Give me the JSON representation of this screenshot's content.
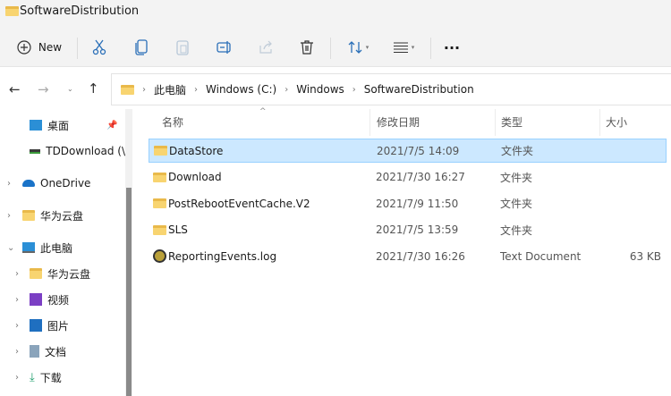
{
  "window": {
    "title": "SoftwareDistribution"
  },
  "toolbar": {
    "new_label": "New",
    "icons": [
      "cut-icon",
      "copy-icon",
      "paste-icon",
      "rename-icon",
      "share-icon",
      "delete-icon",
      "sort-icon",
      "view-icon",
      "more-icon"
    ]
  },
  "nav": {
    "breadcrumb": [
      "此电脑",
      "Windows (C:)",
      "Windows",
      "SoftwareDistribution"
    ]
  },
  "sidebar": {
    "items": [
      {
        "label": "桌面"
      },
      {
        "label": "TDDownload (\\"
      },
      {
        "label": "OneDrive"
      },
      {
        "label": "华为云盘"
      },
      {
        "label": "此电脑"
      },
      {
        "label": "华为云盘"
      },
      {
        "label": "视频"
      },
      {
        "label": "图片"
      },
      {
        "label": "文档"
      },
      {
        "label": "下载"
      }
    ]
  },
  "list": {
    "columns": [
      "名称",
      "修改日期",
      "类型",
      "大小"
    ],
    "rows": [
      {
        "name": "DataStore",
        "date": "2021/7/5 14:09",
        "type": "文件夹",
        "size": "",
        "selected": true
      },
      {
        "name": "Download",
        "date": "2021/7/30 16:27",
        "type": "文件夹",
        "size": ""
      },
      {
        "name": "PostRebootEventCache.V2",
        "date": "2021/7/9 11:50",
        "type": "文件夹",
        "size": ""
      },
      {
        "name": "SLS",
        "date": "2021/7/5 13:59",
        "type": "文件夹",
        "size": ""
      },
      {
        "name": "ReportingEvents.log",
        "date": "2021/7/30 16:26",
        "type": "Text Document",
        "size": "63 KB"
      }
    ]
  },
  "colors": {
    "selection": "#cce8ff",
    "selection_border": "#99d1ff",
    "folder": "#f8d470"
  }
}
